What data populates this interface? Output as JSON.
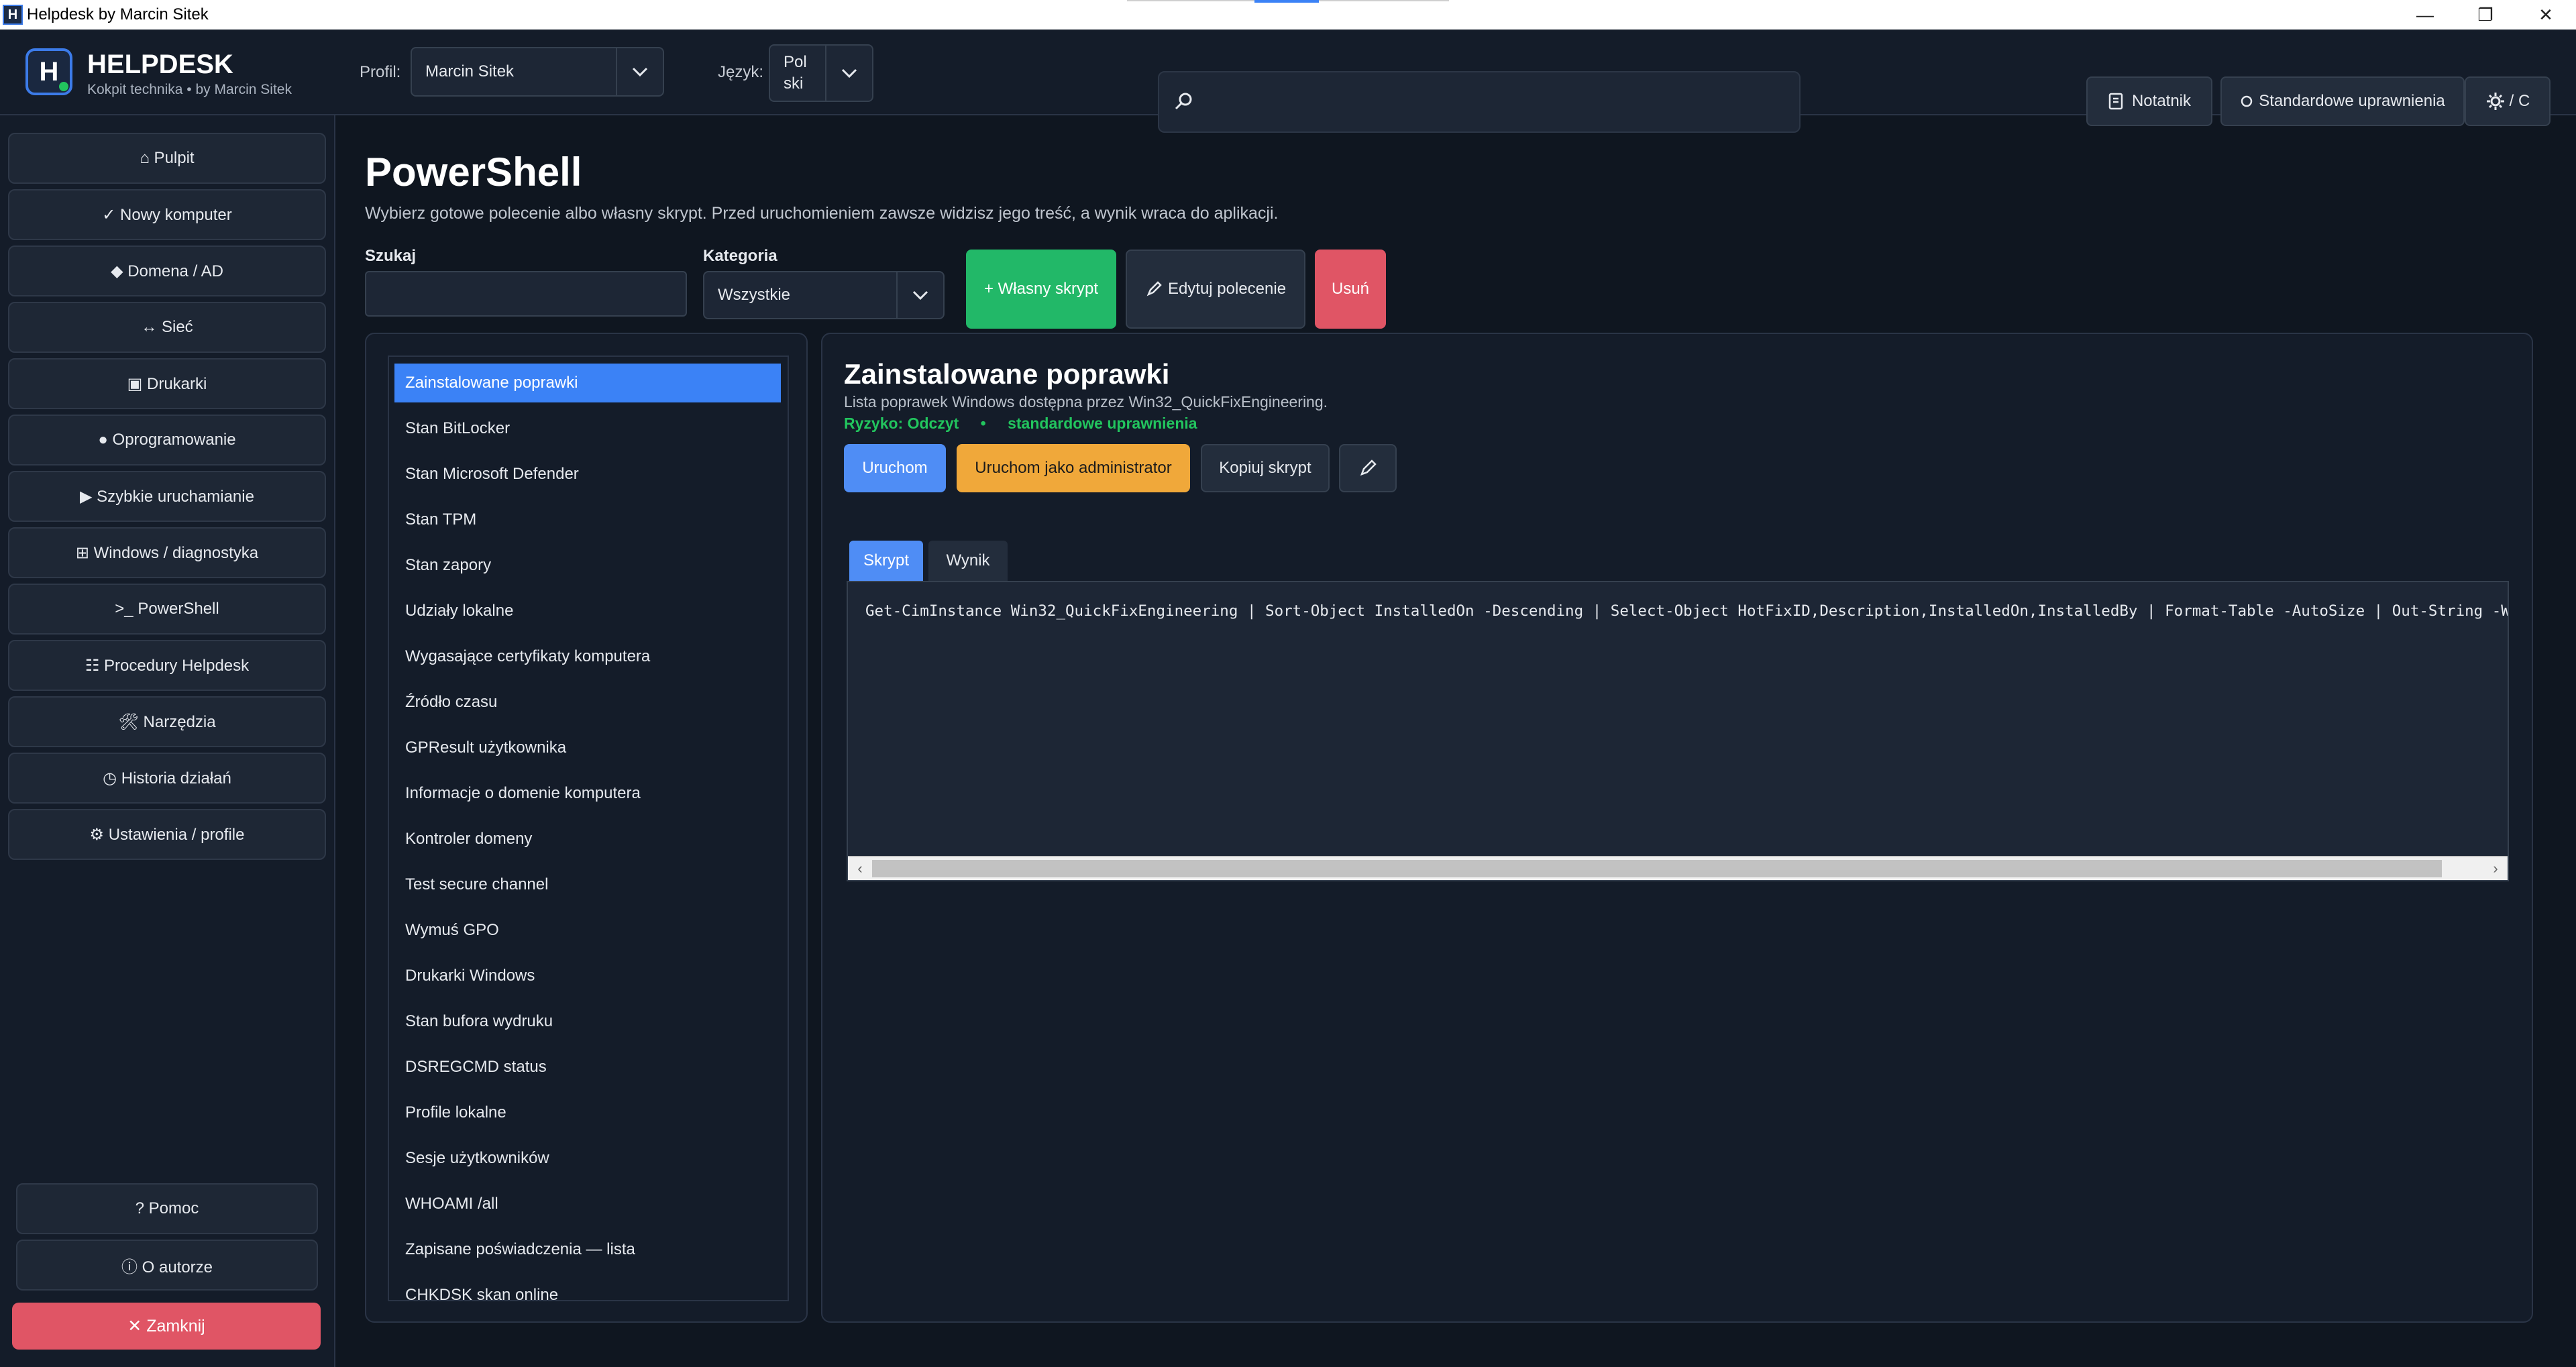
{
  "window": {
    "title": "Helpdesk by Marcin Sitek",
    "icon_text": "H",
    "minimize": "—",
    "restore": "❐",
    "close": "✕"
  },
  "header": {
    "brand": "HELPDESK",
    "subtitle": "Kokpit technika • by Marcin Sitek",
    "logo_letter": "H",
    "profile_label": "Profil:",
    "profile_value": "Marcin Sitek",
    "language_label": "Język:",
    "language_value": "Pol ski",
    "search_value": "",
    "notes_button": "Notatnik",
    "permissions_button": "Standardowe uprawnienia",
    "settings_button": "/ C",
    "icons": {
      "search": "search-icon",
      "notes": "notes-icon",
      "settings": "gear-icon",
      "dropdown": "chevron-down-icon"
    }
  },
  "sidebar": {
    "items": [
      {
        "label": "⌂ Pulpit"
      },
      {
        "label": "✓ Nowy komputer"
      },
      {
        "label": "◆ Domena / AD"
      },
      {
        "label": "↔ Sieć"
      },
      {
        "label": "▣ Drukarki"
      },
      {
        "label": "● Oprogramowanie"
      },
      {
        "label": "▶ Szybkie uruchamianie"
      },
      {
        "label": "⊞ Windows / diagnostyka"
      },
      {
        "label": ">_ PowerShell"
      },
      {
        "label": "☷ Procedury Helpdesk"
      },
      {
        "label": "🛠 Narzędzia"
      },
      {
        "label": "◷ Historia działań"
      },
      {
        "label": "⚙ Ustawienia / profile"
      }
    ],
    "help": "? Pomoc",
    "about": "ⓘ O autorze",
    "close": "✕ Zamknij"
  },
  "main": {
    "title": "PowerShell",
    "description": "Wybierz gotowe polecenie albo własny skrypt. Przed uruchomieniem zawsze widzisz jego treść, a wynik wraca do aplikacji.",
    "search_label": "Szukaj",
    "search_value": "",
    "category_label": "Kategoria",
    "category_value": "Wszystkie",
    "custom_script_button": "+ Własny skrypt",
    "edit_command_button": "Edytuj polecenie",
    "delete_button": "Usuń",
    "commands": [
      "Zainstalowane poprawki",
      "Stan BitLocker",
      "Stan Microsoft Defender",
      "Stan TPM",
      "Stan zapory",
      "Udziały lokalne",
      "Wygasające certyfikaty komputera",
      "Źródło czasu",
      "GPResult użytkownika",
      "Informacje o domenie komputera",
      "Kontroler domeny",
      "Test secure channel",
      "Wymuś GPO",
      "Drukarki Windows",
      "Stan bufora wydruku",
      "DSREGCMD status",
      "Profile lokalne",
      "Sesje użytkowników",
      "WHOAMI /all",
      "Zapisane poświadczenia — lista",
      "CHKDSK skan online"
    ],
    "selected_index": 0,
    "detail": {
      "title": "Zainstalowane poprawki",
      "description": "Lista poprawek Windows dostępna przez Win32_QuickFixEngineering.",
      "risk": "Ryzyko: Odczyt",
      "separator": "•",
      "permissions": "standardowe uprawnienia",
      "run_button": "Uruchom",
      "run_admin_button": "Uruchom jako administrator",
      "copy_button": "Kopiuj skrypt",
      "tabs": [
        "Skrypt",
        "Wynik"
      ],
      "active_tab": "Skrypt",
      "script": "Get-CimInstance Win32_QuickFixEngineering | Sort-Object InstalledOn -Descending | Select-Object HotFixID,Description,InstalledOn,InstalledBy | Format-Table -AutoSize | Out-String -Widt"
    }
  },
  "colors": {
    "accent": "#3b82f6",
    "success": "#22c55e",
    "warning": "#f0a83a",
    "danger": "#e05565",
    "bg": "#0f1620",
    "panel": "#141c29"
  }
}
